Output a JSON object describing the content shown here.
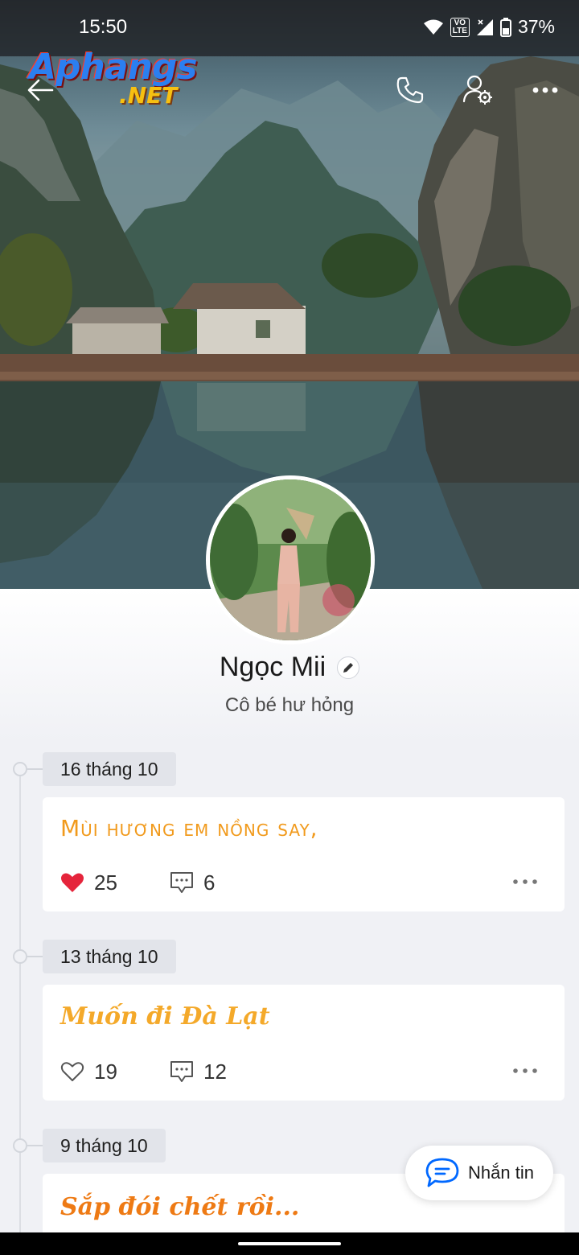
{
  "status_bar": {
    "time": "15:50",
    "battery": "37%",
    "volte": "VO\nLTE"
  },
  "watermark": {
    "line1": "Aphangs",
    "line2": ".NET"
  },
  "nav": {
    "back_icon": "arrow-left-icon",
    "call_icon": "phone-icon",
    "settings_icon": "user-settings-icon",
    "more_icon": "more-horizontal-icon"
  },
  "profile": {
    "name": "Ngọc Mii",
    "bio": "Cô bé hư hỏng"
  },
  "posts": [
    {
      "date": "16 tháng 10",
      "text": "Mùi hương em nồng say,",
      "likes": "25",
      "comments": "6",
      "liked": true
    },
    {
      "date": "13 tháng 10",
      "text": "Muốn đi Đà Lạt",
      "likes": "19",
      "comments": "12",
      "liked": false
    },
    {
      "date": "9 tháng 10",
      "text": "Sắp đói chết rồi..."
    }
  ],
  "message_button": {
    "label": "Nhắn tin"
  },
  "colors": {
    "accent": "#0068ff",
    "like_red": "#e5243b",
    "post_orange": "#f0a020"
  }
}
